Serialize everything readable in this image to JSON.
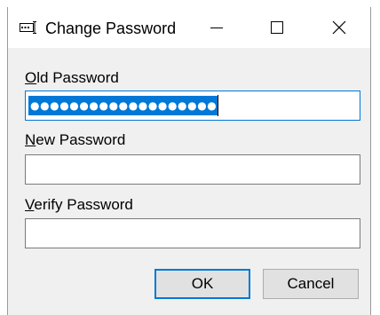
{
  "window": {
    "title": "Change Password",
    "icon": "password-field-icon",
    "controls": {
      "minimize": "minimize-icon",
      "maximize": "maximize-icon",
      "close": "close-icon"
    }
  },
  "form": {
    "old_password": {
      "label_mnemonic": "O",
      "label_rest": "ld Password",
      "masked_value": "●●●●●●●●●●●●●●●●●●●",
      "selected": true
    },
    "new_password": {
      "label_mnemonic": "N",
      "label_rest": "ew Password",
      "masked_value": ""
    },
    "verify_password": {
      "label_mnemonic": "V",
      "label_rest": "erify Password",
      "masked_value": ""
    }
  },
  "buttons": {
    "ok_label": "OK",
    "cancel_label": "Cancel"
  },
  "colors": {
    "accent": "#0078d7",
    "dialog_bg": "#f0f0f0",
    "titlebar_bg": "#ffffff"
  }
}
